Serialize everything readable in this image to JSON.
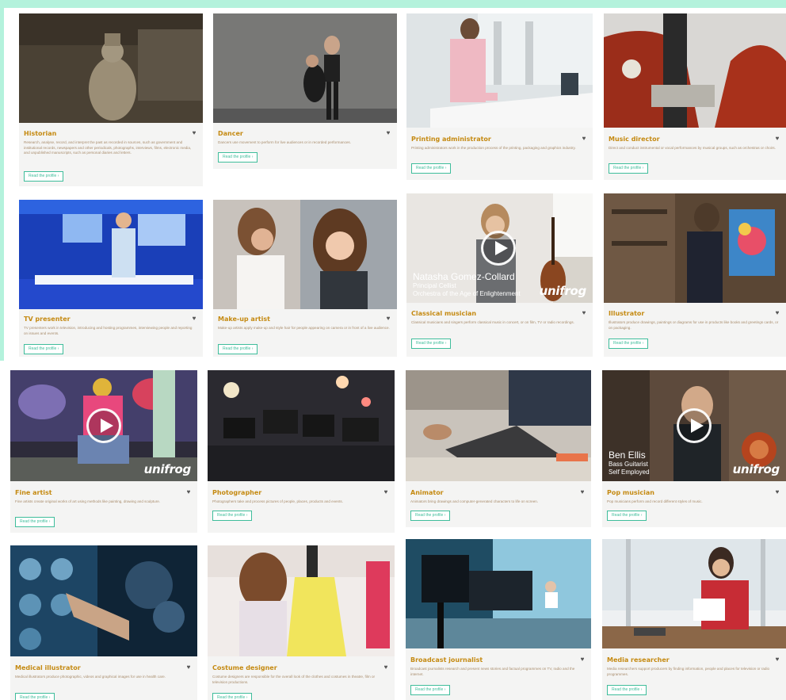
{
  "colors": {
    "background": "#b4f2dc",
    "accent": "#3fbd9b",
    "title": "#c58a12",
    "card": "#f4f4f3"
  },
  "cards": [
    {
      "title": "Historian",
      "desc": "Research, analyse, record, and interpret the past as recorded in sources, such as government and institutional records, newspapers and other periodicals, photographs, interviews, films, electronic media, and unpublished manuscripts, such as personal diaries and letters.",
      "button": "Read the profile",
      "icon": "heart-icon"
    },
    {
      "title": "Dancer",
      "desc": "Dancers use movement to perform for live audiences or in recorded performances.",
      "button": "Read the profile",
      "icon": "heart-icon"
    },
    {
      "title": "Printing administrator",
      "desc": "Printing administrators work in the production process of the printing, packaging and graphics industry.",
      "button": "Read the profile",
      "icon": "heart-icon"
    },
    {
      "title": "Music director",
      "desc": "Direct and conduct instrumental or vocal performances by musical groups, such as orchestras or choirs.",
      "button": "Read the profile",
      "icon": "heart-icon"
    },
    {
      "title": "TV presenter",
      "desc": "TV presenters work in television, introducing and hosting programmes, interviewing people and reporting on issues and events.",
      "button": "Read the profile",
      "icon": "heart-icon"
    },
    {
      "title": "Make-up artist",
      "desc": "Make-up artists apply make-up and style hair for people appearing on camera or in front of a live audience.",
      "button": "Read the profile",
      "icon": "heart-icon"
    },
    {
      "title": "Classical musician",
      "desc": "Classical musicians and singers perform classical music in concert, or on film, TV or radio recordings.",
      "button": "Read the profile",
      "icon": "heart-icon",
      "video": {
        "caption_name": "Natasha Gomez-Collard",
        "caption_role": "Principal Cellist",
        "caption_org": "Orchestra of the Age of Enlightenment",
        "brand": "unifrog"
      }
    },
    {
      "title": "Illustrator",
      "desc": "Illustrators produce drawings, paintings or diagrams for use in products like books and greetings cards, or on packaging.",
      "button": "Read the profile",
      "icon": "heart-icon"
    },
    {
      "title": "Fine artist",
      "desc": "Fine artists create original works of art using methods like painting, drawing and sculpture.",
      "button": "Read the profile",
      "icon": "heart-icon",
      "video": {
        "brand": "unifrog"
      }
    },
    {
      "title": "Photographer",
      "desc": "Photographers take and process pictures of people, places, products and events.",
      "button": "Read the profile",
      "icon": "heart-icon"
    },
    {
      "title": "Animator",
      "desc": "Animators bring drawings and computer-generated characters to life on screen.",
      "button": "Read the profile",
      "icon": "heart-icon"
    },
    {
      "title": "Pop musician",
      "desc": "Pop musicians perform and record different styles of music.",
      "button": "Read the profile",
      "icon": "heart-icon",
      "video": {
        "caption_name": "Ben Ellis",
        "caption_role": "Bass Guitarist",
        "caption_org": "Self Employed",
        "brand": "unifrog"
      }
    },
    {
      "title": "Medical illustrator",
      "desc": "Medical illustrators produce photographic, videos and graphical images for use in health care.",
      "button": "Read the profile",
      "icon": "heart-icon"
    },
    {
      "title": "Costume designer",
      "desc": "Costume designers are responsible for the overall look of the clothes and costumes in theatre, film or television productions.",
      "button": "Read the profile",
      "icon": "heart-icon"
    },
    {
      "title": "Broadcast journalist",
      "desc": "Broadcast journalists research and present news stories and factual programmes on TV, radio and the internet.",
      "button": "Read the profile",
      "icon": "heart-icon"
    },
    {
      "title": "Media researcher",
      "desc": "Media researchers support producers by finding information, people and places for television or radio programmes.",
      "button": "Read the profile",
      "icon": "heart-icon"
    }
  ]
}
